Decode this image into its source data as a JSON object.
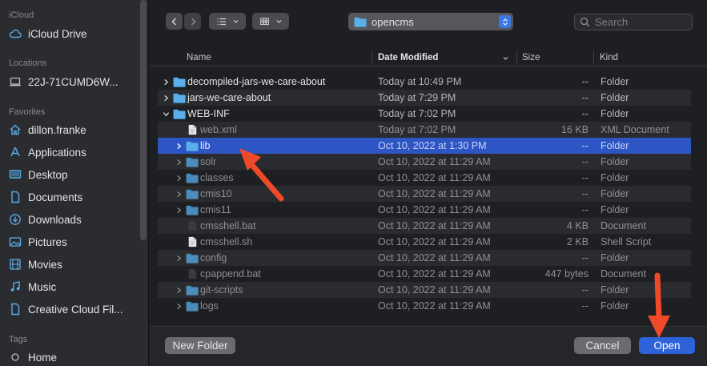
{
  "sidebar": {
    "sections": [
      {
        "header": "iCloud",
        "items": [
          {
            "label": "iCloud Drive",
            "icon": "cloud-icon"
          }
        ]
      },
      {
        "header": "Locations",
        "items": [
          {
            "label": "22J-71CUMD6W...",
            "icon": "laptop-icon"
          }
        ]
      },
      {
        "header": "Favorites",
        "items": [
          {
            "label": "dillon.franke",
            "icon": "home-icon"
          },
          {
            "label": "Applications",
            "icon": "applications-icon"
          },
          {
            "label": "Desktop",
            "icon": "desktop-icon"
          },
          {
            "label": "Documents",
            "icon": "document-icon"
          },
          {
            "label": "Downloads",
            "icon": "download-icon"
          },
          {
            "label": "Pictures",
            "icon": "pictures-icon"
          },
          {
            "label": "Movies",
            "icon": "movies-icon"
          },
          {
            "label": "Music",
            "icon": "music-icon"
          },
          {
            "label": "Creative Cloud Fil...",
            "icon": "file-icon"
          }
        ]
      },
      {
        "header": "Tags",
        "items": [
          {
            "label": "Home",
            "icon": "tag-dot-icon"
          }
        ]
      }
    ]
  },
  "toolbar": {
    "location": "opencms",
    "search_placeholder": "Search"
  },
  "columns": {
    "name": "Name",
    "date": "Date Modified",
    "size": "Size",
    "kind": "Kind"
  },
  "rows": [
    {
      "name": "decompiled-jars-we-care-about",
      "date": "Today at 10:49 PM",
      "size": "--",
      "kind": "Folder",
      "type": "folder",
      "level": 0,
      "expanded": false,
      "style": "top"
    },
    {
      "name": "jars-we-care-about",
      "date": "Today at 7:29 PM",
      "size": "--",
      "kind": "Folder",
      "type": "folder",
      "level": 0,
      "expanded": false,
      "style": "top"
    },
    {
      "name": "WEB-INF",
      "date": "Today at 7:02 PM",
      "size": "--",
      "kind": "Folder",
      "type": "folder",
      "level": 0,
      "expanded": true,
      "style": "top"
    },
    {
      "name": "web.xml",
      "date": "Today at 7:02 PM",
      "size": "16 KB",
      "kind": "XML Document",
      "type": "file",
      "level": 1,
      "style": "dim"
    },
    {
      "name": "lib",
      "date": "Oct 10, 2022 at 1:30 PM",
      "size": "--",
      "kind": "Folder",
      "type": "folder",
      "level": 1,
      "expanded": false,
      "style": "sel"
    },
    {
      "name": "solr",
      "date": "Oct 10, 2022 at 11:29 AM",
      "size": "--",
      "kind": "Folder",
      "type": "folder",
      "level": 1,
      "expanded": false,
      "style": "dim"
    },
    {
      "name": "classes",
      "date": "Oct 10, 2022 at 11:29 AM",
      "size": "--",
      "kind": "Folder",
      "type": "folder",
      "level": 1,
      "expanded": false,
      "style": "dim"
    },
    {
      "name": "cmis10",
      "date": "Oct 10, 2022 at 11:29 AM",
      "size": "--",
      "kind": "Folder",
      "type": "folder",
      "level": 1,
      "expanded": false,
      "style": "dim"
    },
    {
      "name": "cmis11",
      "date": "Oct 10, 2022 at 11:29 AM",
      "size": "--",
      "kind": "Folder",
      "type": "folder",
      "level": 1,
      "expanded": false,
      "style": "dim"
    },
    {
      "name": "cmsshell.bat",
      "date": "Oct 10, 2022 at 11:29 AM",
      "size": "4 KB",
      "kind": "Document",
      "type": "darkfile",
      "level": 1,
      "style": "dim"
    },
    {
      "name": "cmsshell.sh",
      "date": "Oct 10, 2022 at 11:29 AM",
      "size": "2 KB",
      "kind": "Shell Script",
      "type": "file",
      "level": 1,
      "style": "dim"
    },
    {
      "name": "config",
      "date": "Oct 10, 2022 at 11:29 AM",
      "size": "--",
      "kind": "Folder",
      "type": "folder",
      "level": 1,
      "expanded": false,
      "style": "dim"
    },
    {
      "name": "cpappend.bat",
      "date": "Oct 10, 2022 at 11:29 AM",
      "size": "447 bytes",
      "kind": "Document",
      "type": "darkfile",
      "level": 1,
      "style": "dim"
    },
    {
      "name": "git-scripts",
      "date": "Oct 10, 2022 at 11:29 AM",
      "size": "--",
      "kind": "Folder",
      "type": "folder",
      "level": 1,
      "expanded": false,
      "style": "dim"
    },
    {
      "name": "logs",
      "date": "Oct 10, 2022 at 11:29 AM",
      "size": "--",
      "kind": "Folder",
      "type": "folder",
      "level": 1,
      "expanded": false,
      "style": "dim"
    }
  ],
  "buttons": {
    "new_folder": "New Folder",
    "cancel": "Cancel",
    "open": "Open"
  },
  "colors": {
    "accent": "#2d62d8",
    "selection": "#2e55c4",
    "folder": "#5aaeea",
    "annotation_arrow": "#ee4a2a"
  }
}
